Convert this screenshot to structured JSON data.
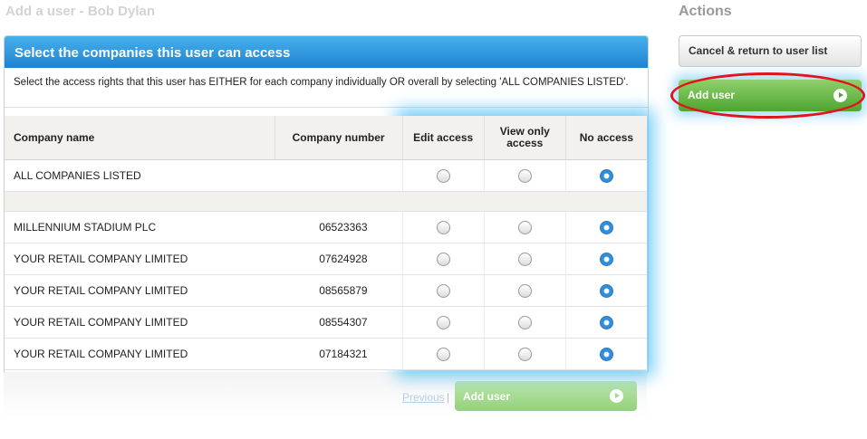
{
  "page": {
    "title": "Add a user - Bob Dylan"
  },
  "actions": {
    "title": "Actions",
    "cancel_label": "Cancel & return to user list",
    "add_label": "Add user"
  },
  "panel": {
    "heading": "Select the companies this user can access",
    "intro": "Select the access rights that this user has EITHER for each company individually OR overall by selecting 'ALL COMPANIES LISTED'."
  },
  "table": {
    "headers": {
      "name": "Company name",
      "number": "Company number",
      "edit": "Edit access",
      "view": "View only access",
      "none": "No access"
    },
    "all_row": {
      "name": "ALL COMPANIES LISTED",
      "selected": "none"
    },
    "rows": [
      {
        "name": "MILLENNIUM STADIUM PLC",
        "number": "06523363",
        "selected": "none"
      },
      {
        "name": "YOUR RETAIL COMPANY LIMITED",
        "number": "07624928",
        "selected": "none"
      },
      {
        "name": "YOUR RETAIL COMPANY LIMITED",
        "number": "08565879",
        "selected": "none"
      },
      {
        "name": "YOUR RETAIL COMPANY LIMITED",
        "number": "08554307",
        "selected": "none"
      },
      {
        "name": "YOUR RETAIL COMPANY LIMITED",
        "number": "07184321",
        "selected": "none"
      }
    ]
  },
  "footer": {
    "previous_label": "Previous",
    "separator": "|",
    "add_label": "Add user"
  },
  "colors": {
    "header_blue": "#1f84d1",
    "button_green": "#4ea52f",
    "radio_selected": "#2f8fd8",
    "annotation_red": "#e3131b",
    "glow_blue": "#6fcaf7"
  }
}
